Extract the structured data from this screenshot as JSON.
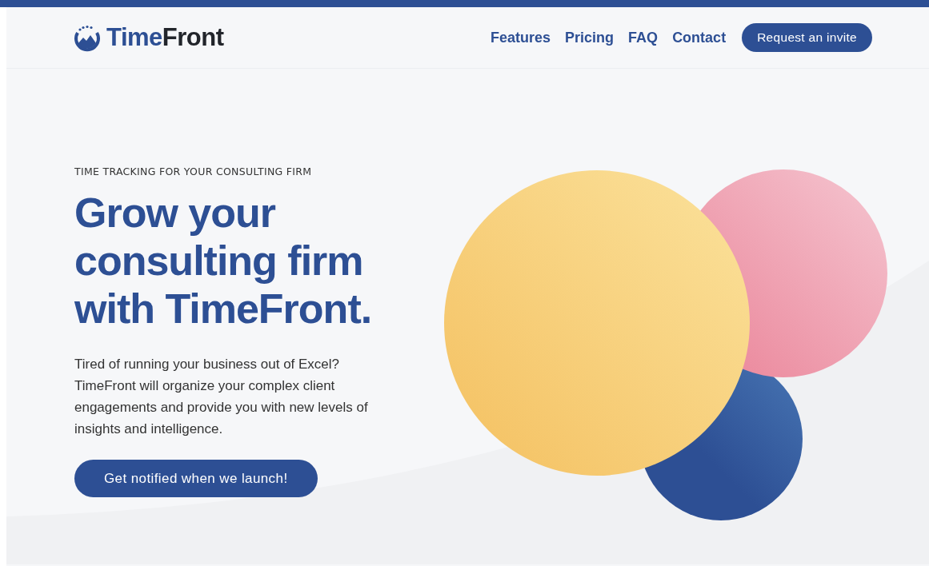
{
  "header": {
    "brand": [
      "Time",
      "Front"
    ],
    "nav": [
      {
        "label": "Features"
      },
      {
        "label": "Pricing"
      },
      {
        "label": "FAQ"
      },
      {
        "label": "Contact"
      }
    ],
    "invite_button": "Request an invite"
  },
  "hero": {
    "eyebrow": "TIME TRACKING FOR YOUR CONSULTING FIRM",
    "heading": [
      "Grow your",
      "consulting firm",
      "with TimeFront."
    ],
    "body": "Tired of running your business out of Excel? TimeFront will organize your complex client engagements and provide you with new levels of insights and intelligence.",
    "cta_button": "Get notified when we launch!"
  }
}
